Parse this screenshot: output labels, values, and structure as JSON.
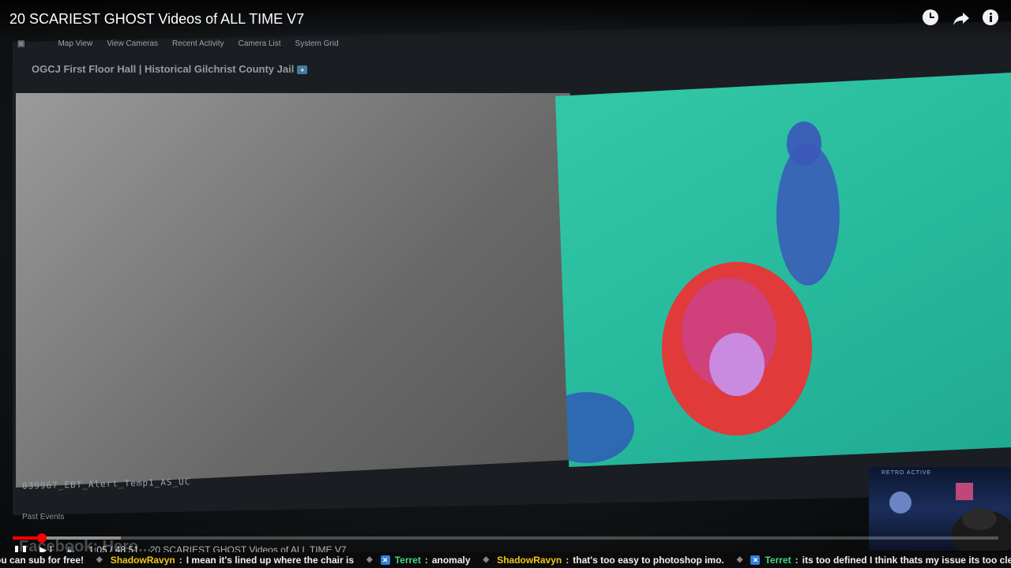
{
  "video": {
    "title": "20 SCARIEST GHOST Videos of ALL TIME V7"
  },
  "top_actions": {
    "watch_later_icon": "clock-icon",
    "share_icon": "share-icon",
    "info_icon": "info-icon"
  },
  "monitor": {
    "nav": [
      "Map View",
      "View Cameras",
      "Recent Activity",
      "Camera List",
      "System Grid"
    ],
    "camera_title": "OGCJ First Floor Hall | Historical Gilchrist County Jail",
    "camera_code": "039967_EBT_Alert_Temp1_AS_UC",
    "past_events_label": "Past Events",
    "watermark": "Facebook: Hero..."
  },
  "player": {
    "time": "1:05 / 48:51",
    "chapter": "20 SCARIEST GHOST Videos of ALL TIME V7",
    "progress_played": 0.03,
    "progress_loaded": 0.11,
    "accent_color": "#ff0000"
  },
  "chat_ticker": [
    {
      "user": "",
      "text": "ou can sub for free!"
    },
    {
      "user": "ShadowRavyn",
      "text": "I mean it's lined up where the chair is",
      "user_color": "#f5c518"
    },
    {
      "user": "Terret",
      "text": "anomaly",
      "user_color": "#3ddc84"
    },
    {
      "user": "ShadowRavyn",
      "text": "that's too easy to photoshop imo.",
      "user_color": "#f5c518"
    },
    {
      "user": "Terret",
      "text": "its too defined I think thats my issue its too clean",
      "user_color": "#3ddc84"
    }
  ]
}
